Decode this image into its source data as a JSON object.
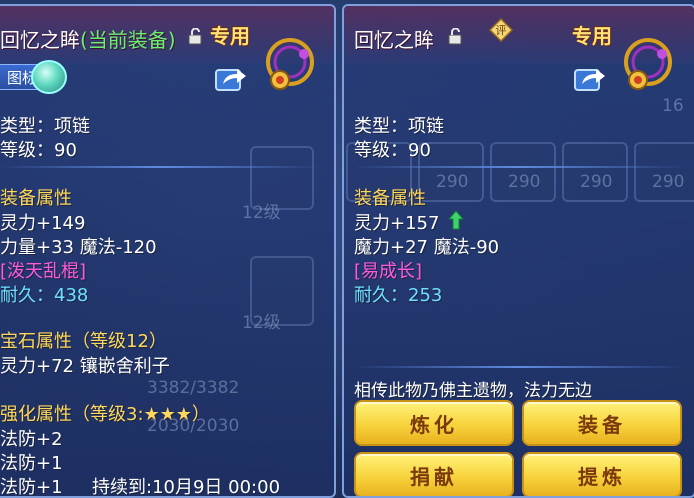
{
  "left_panel": {
    "title": "回忆之眸",
    "equipped_tag": "(当前装备)",
    "special": "专用",
    "icon_label_badge": "图标",
    "type_line": "类型：项链",
    "level_line": "等级：90",
    "equip_attr_header": "装备属性",
    "attr1": "灵力+149",
    "attr2": "力量+33 魔法-120",
    "enchant": "[泼天乱棍]",
    "durability_label": "耐久：",
    "durability_value": "438",
    "gem_header": "宝石属性（等级12）",
    "gem_line": "灵力+72 镶嵌舍利子",
    "enhance_header": "强化属性（等级3:★★★）",
    "enhance1": "法防+2",
    "enhance2": "法防+1",
    "enhance3": "法防+1",
    "duration": "持续到:10月9日 00:00"
  },
  "right_panel": {
    "title": "回忆之眸",
    "special": "专用",
    "type_line": "类型：项链",
    "level_line": "等级：90",
    "equip_attr_header": "装备属性",
    "attr1": "灵力+157",
    "attr2": "魔力+27 魔法-90",
    "enchant": "[易成长]",
    "durability_label": "耐久：",
    "durability_value": "253",
    "description": "相传此物乃佛主遗物，法力无边",
    "buttons": {
      "refine": "炼化",
      "equip": "装备",
      "donate": "捐献",
      "extract": "提炼"
    }
  },
  "background_numbers": [
    "290",
    "290",
    "290",
    "290",
    "16",
    "12级",
    "12级",
    "3382/3382",
    "2030/2030"
  ],
  "colors": {
    "accent_gold": "#ffd75a",
    "equipped_green": "#6cf06c",
    "enchant_magenta": "#ff5adc",
    "durability_cyan": "#6de0ff",
    "button_yellow": "#f7d33c"
  }
}
